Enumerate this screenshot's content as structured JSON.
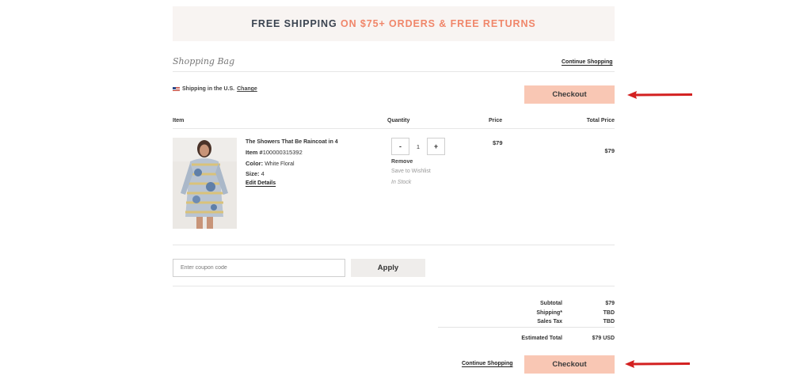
{
  "banner": {
    "part1": "FREE SHIPPING",
    "part2": " ON $75+ ORDERS",
    "part3": " & ",
    "part4": "FREE RETURNS"
  },
  "bag": {
    "title": "Shopping Bag",
    "continue_label": "Continue Shopping",
    "shipping_text": "Shipping in the U.S.",
    "change_label": "Change",
    "checkout_label": "Checkout"
  },
  "table": {
    "headers": {
      "item": "Item",
      "quantity": "Quantity",
      "price": "Price",
      "total_price": "Total Price"
    }
  },
  "item": {
    "name": "The Showers That Be Raincoat in 4",
    "item_label": "Item #",
    "item_number": "100000315392",
    "color_label": "Color:",
    "color_value": "White Floral",
    "size_label": "Size:",
    "size_value": "4",
    "edit_label": "Edit Details",
    "quantity": "1",
    "minus": "-",
    "plus": "+",
    "remove_label": "Remove",
    "wishlist_label": "Save to Wishlist",
    "stock_status": "In Stock",
    "price": "$79",
    "total_price": "$79"
  },
  "coupon": {
    "placeholder": "Enter coupon code",
    "apply_label": "Apply"
  },
  "summary": {
    "subtotal_label": "Subtotal",
    "subtotal_value": "$79",
    "shipping_label": "Shipping*",
    "shipping_value": "TBD",
    "tax_label": "Sales Tax",
    "tax_value": "TBD",
    "estimated_label": "Estimated Total",
    "estimated_value": "$79 USD"
  },
  "footer": {
    "continue_label": "Continue Shopping",
    "checkout_label": "Checkout"
  },
  "colors": {
    "checkout_bg": "#f9c7b4",
    "banner_accent": "#f0866a",
    "arrow": "#d32020"
  },
  "icons": [
    "us-flag-icon",
    "red-arrow-icon"
  ]
}
